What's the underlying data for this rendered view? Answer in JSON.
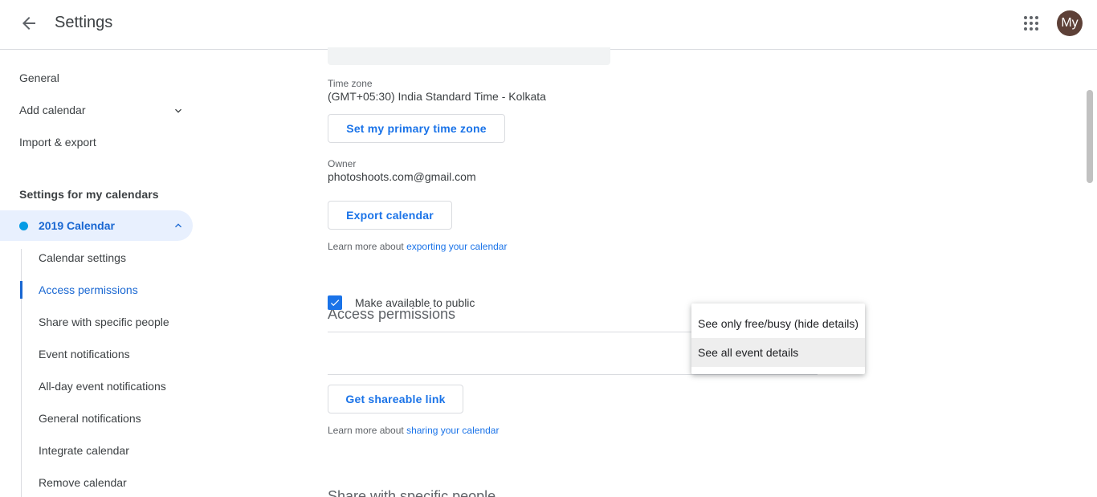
{
  "header": {
    "title": "Settings",
    "avatar_initials": "My"
  },
  "sidebar": {
    "items": [
      {
        "label": "General"
      },
      {
        "label": "Add calendar"
      },
      {
        "label": "Import & export"
      }
    ],
    "section_heading": "Settings for my calendars",
    "calendar": {
      "name": "2019 Calendar",
      "color": "#039be5"
    },
    "sub_items": [
      {
        "label": "Calendar settings"
      },
      {
        "label": "Access permissions"
      },
      {
        "label": "Share with specific people"
      },
      {
        "label": "Event notifications"
      },
      {
        "label": "All-day event notifications"
      },
      {
        "label": "General notifications"
      },
      {
        "label": "Integrate calendar"
      },
      {
        "label": "Remove calendar"
      }
    ]
  },
  "main": {
    "timezone_label": "Time zone",
    "timezone_value": "(GMT+05:30) India Standard Time - Kolkata",
    "set_timezone_button": "Set my primary time zone",
    "owner_label": "Owner",
    "owner_value": "photoshoots.com@gmail.com",
    "export_button": "Export calendar",
    "export_learn_prefix": "Learn more about ",
    "export_learn_link": "exporting your calendar",
    "access_title": "Access permissions",
    "make_public_label": "Make available to public",
    "shareable_link_button": "Get shareable link",
    "sharing_learn_prefix": "Learn more about ",
    "sharing_learn_link": "sharing your calendar",
    "next_section_title": "Share with specific people"
  },
  "menu": {
    "options": [
      {
        "label": "See only free/busy (hide details)"
      },
      {
        "label": "See all event details"
      }
    ],
    "selected_index": 1
  },
  "colors": {
    "accent": "#1a73e8",
    "active_text": "#1967d2",
    "active_bg": "#e8f0fe",
    "avatar_bg": "#5d4037"
  }
}
